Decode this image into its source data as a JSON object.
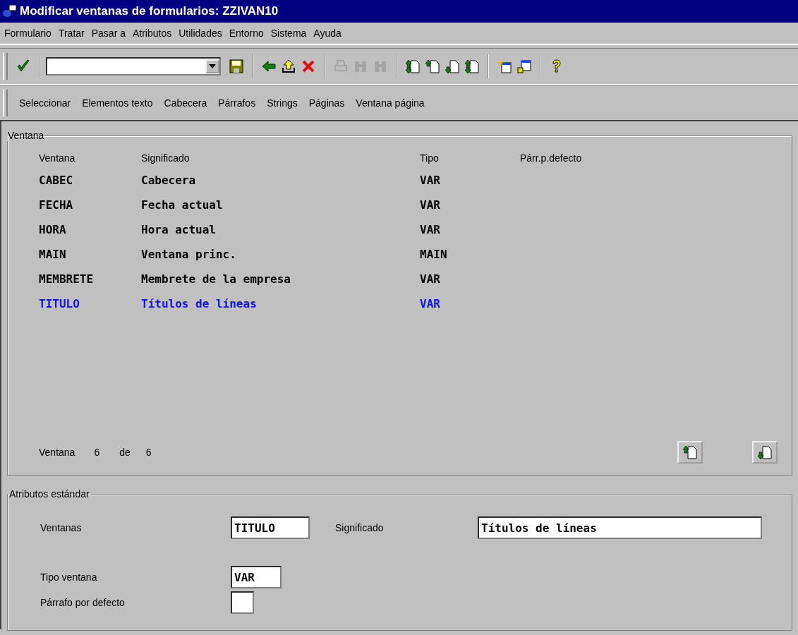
{
  "window": {
    "title": "Modificar ventanas de formularios: ZZIVAN10"
  },
  "menu": [
    "Formulario",
    "Tratar",
    "Pasar a",
    "Atributos",
    "Utilidades",
    "Entorno",
    "Sistema",
    "Ayuda"
  ],
  "toolbar": {
    "groups": [
      [
        {
          "kind": "check",
          "disabled": false
        }
      ],
      [
        {
          "kind": "save",
          "disabled": false
        }
      ],
      [
        {
          "kind": "back",
          "disabled": false
        },
        {
          "kind": "up",
          "disabled": false
        },
        {
          "kind": "cancel",
          "disabled": false
        }
      ],
      [
        {
          "kind": "print",
          "disabled": true
        },
        {
          "kind": "find",
          "disabled": true
        },
        {
          "kind": "findnext",
          "disabled": true
        }
      ],
      [
        {
          "kind": "first",
          "disabled": false
        },
        {
          "kind": "prev",
          "disabled": false
        },
        {
          "kind": "next",
          "disabled": false
        },
        {
          "kind": "last",
          "disabled": false
        }
      ],
      [
        {
          "kind": "create",
          "disabled": false
        },
        {
          "kind": "windows",
          "disabled": false
        }
      ],
      [
        {
          "kind": "help",
          "disabled": false
        }
      ]
    ]
  },
  "app_toolbar": [
    "Seleccionar",
    "Elementos texto",
    "Cabecera",
    "Párrafos",
    "Strings",
    "Páginas",
    "Ventana página"
  ],
  "window_group": {
    "title": "Ventana",
    "columns": [
      "Ventana",
      "Significado",
      "Tipo",
      "Párr.p.defecto"
    ],
    "rows": [
      {
        "ventana": "CABEC",
        "significado": "Cabecera",
        "tipo": "VAR",
        "selected": false
      },
      {
        "ventana": "FECHA",
        "significado": "Fecha actual",
        "tipo": "VAR",
        "selected": false
      },
      {
        "ventana": "HORA",
        "significado": "Hora actual",
        "tipo": "VAR",
        "selected": false
      },
      {
        "ventana": "MAIN",
        "significado": "Ventana princ.",
        "tipo": "MAIN",
        "selected": false
      },
      {
        "ventana": "MEMBRETE",
        "significado": "Membrete de la empresa",
        "tipo": "VAR",
        "selected": false
      },
      {
        "ventana": "TITULO",
        "significado": "Títulos de líneas",
        "tipo": "VAR",
        "selected": true
      }
    ],
    "counter": {
      "label": "Ventana",
      "current": "6",
      "of": "de",
      "total": "6"
    }
  },
  "attributes_group": {
    "title": "Atributos estándar",
    "ventanas": {
      "label": "Ventanas",
      "value": "TITULO"
    },
    "significado": {
      "label": "Significado",
      "value": "Títulos de líneas"
    },
    "tipo": {
      "label": "Tipo ventana",
      "value": "VAR"
    },
    "parrafo": {
      "label": "Párrafo por defecto"
    }
  }
}
